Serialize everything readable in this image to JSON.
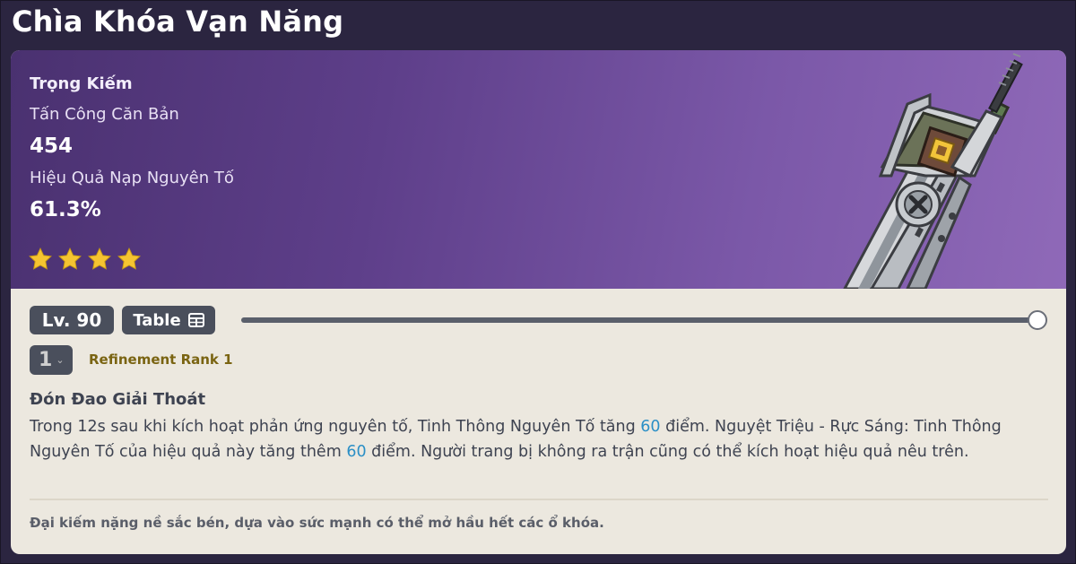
{
  "page": {
    "title": "Chìa Khóa Vạn Năng"
  },
  "weapon": {
    "type": "Trọng Kiếm",
    "stat1_label": "Tấn Công Căn Bản",
    "stat1_value": "454",
    "stat2_label": "Hiệu Quả Nạp Nguyên Tố",
    "stat2_value": "61.3%",
    "rarity_stars": 4,
    "star_color": "#f5c431",
    "image_icon": "greatsword-icon"
  },
  "controls": {
    "level": "Lv. 90",
    "table_label": "Table",
    "table_icon": "table-grid-icon",
    "level_slider_fraction": 1.0
  },
  "refinement": {
    "selected": "1",
    "label": "Refinement Rank 1"
  },
  "passive": {
    "name": "Đón Đao Giải Thoát",
    "desc_part1": "Trong 12s sau khi kích hoạt phản ứng nguyên tố, Tinh Thông Nguyên Tố tăng ",
    "value1": "60",
    "desc_part2": " điểm. Nguyệt Triệu - Rực Sáng: Tinh Thông Nguyên Tố của hiệu quả này tăng thêm ",
    "value2": "60",
    "desc_part3": " điểm. Người trang bị không ra trận cũng có thể kích hoạt hiệu quả nêu trên.",
    "highlight_color": "#2b8fc6"
  },
  "lore": "Đại kiếm nặng nề sắc bén, dựa vào sức mạnh có thể mở hầu hết các ổ khóa."
}
